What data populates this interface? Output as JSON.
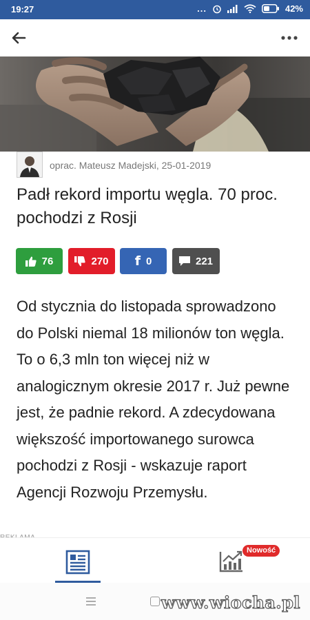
{
  "status_bar": {
    "time": "19:27",
    "dots": "...",
    "battery_percent": "42%"
  },
  "icons": {
    "back": "arrow-left-icon",
    "more": "more-horizontal-icon",
    "like": "thumbs-up-icon",
    "dislike": "thumbs-down-icon",
    "facebook": "facebook-icon",
    "comments": "comment-icon",
    "news": "newspaper-icon",
    "trending": "chart-trending-icon",
    "menu": "menu-icon",
    "home": "home-square-icon"
  },
  "article": {
    "byline": "oprac. Mateusz Madejski, 25-01-2019",
    "title": "Padł rekord importu węgla. 70 proc. pochodzi z Rosji",
    "body": "Od stycznia do listopada sprowadzono do Polski niemal 18 milionów ton węgla. To o 6,3 mln ton więcej niż w analogicznym okresie 2017 r. Już pewne jest, że padnie rekord. A zdecydowana większość importowanego surowca pochodzi z Rosji - wskazuje raport Agencji Rozwoju Przemysłu."
  },
  "actions": {
    "likes": "76",
    "dislikes": "270",
    "facebook_label": "f",
    "facebook_shares": "0",
    "comments": "221"
  },
  "ad_label": "REKLAMA",
  "bottom_nav": {
    "badge": "Nowość"
  },
  "watermark": "www.wiocha.pl",
  "colors": {
    "status_bar": "#2f5b9e",
    "like": "#2e9e3e",
    "dislike": "#e21d2a",
    "facebook": "#3565b4",
    "comments": "#4f4f4f",
    "badge": "#e02b2b"
  }
}
